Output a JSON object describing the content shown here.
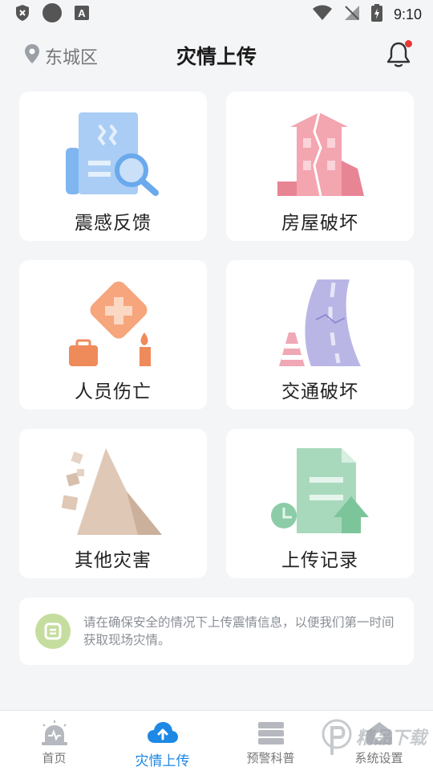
{
  "status_bar": {
    "time": "9:10"
  },
  "header": {
    "location": "东城区",
    "title": "灾情上传"
  },
  "cards": [
    {
      "label": "震感反馈"
    },
    {
      "label": "房屋破坏"
    },
    {
      "label": "人员伤亡"
    },
    {
      "label": "交通破坏"
    },
    {
      "label": "其他灾害"
    },
    {
      "label": "上传记录"
    }
  ],
  "notice": {
    "text": "请在确保安全的情况下上传震情信息，以便我们第一时间获取现场灾情。"
  },
  "bottom_nav": [
    {
      "label": "首页"
    },
    {
      "label": "灾情上传"
    },
    {
      "label": "预警科普"
    },
    {
      "label": "系统设置"
    }
  ],
  "watermark": {
    "text": "精品下载"
  },
  "colors": {
    "accent": "#1e88e5",
    "notice_icon_bg": "#c5dd9f",
    "badge": "#e53935"
  }
}
